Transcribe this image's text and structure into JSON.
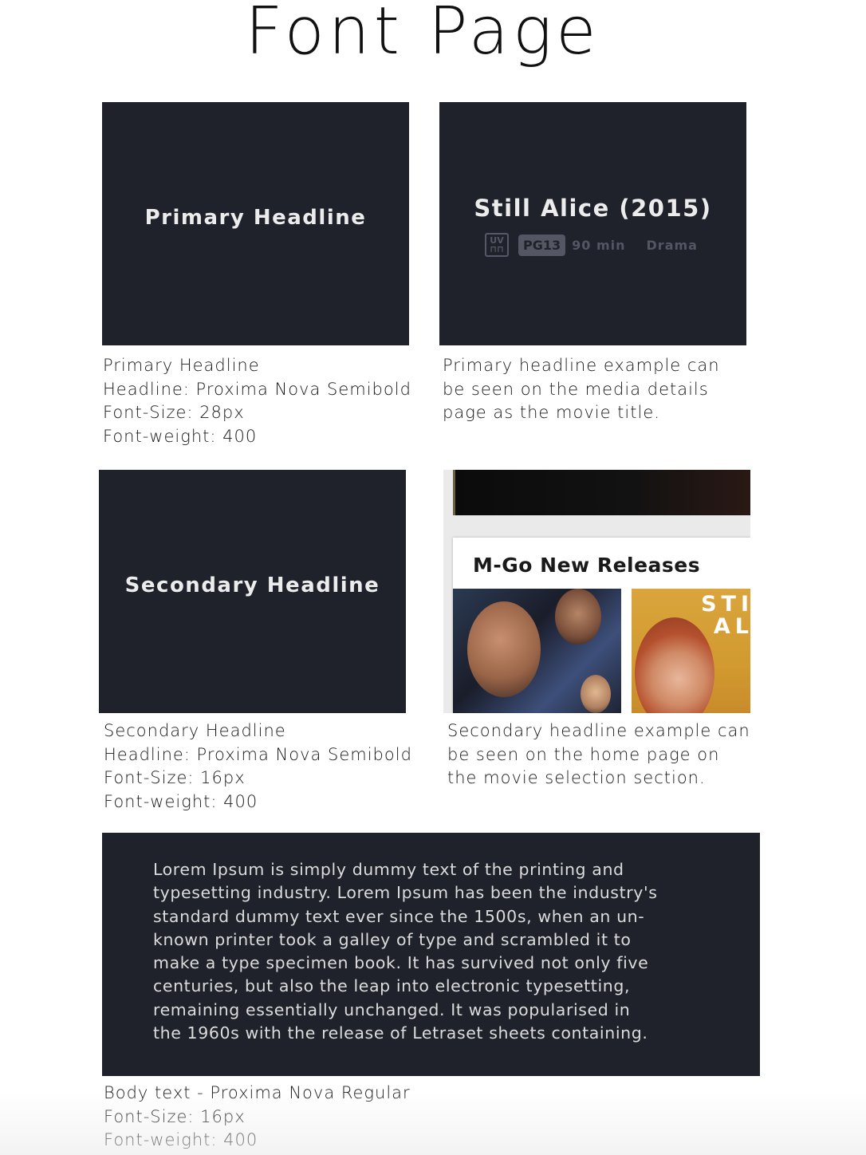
{
  "page": {
    "title": "Font Page"
  },
  "primary": {
    "sample": "Primary Headline",
    "caption": [
      "Primary Headline",
      "Headline: Proxima Nova Semibold",
      "Font-Size: 28px",
      "Font-weight: 400"
    ],
    "example": {
      "movie_title": "Still Alice (2015)",
      "uv_top": "UV",
      "uv_bottom": "⊓⊓",
      "rating": "PG13",
      "runtime": "90 min",
      "genre": "Drama"
    },
    "example_caption": [
      "Primary headline example can",
      "be seen on the media details",
      "page as the movie title."
    ]
  },
  "secondary": {
    "sample": "Secondary Headline",
    "caption": [
      "Secondary Headline",
      "Headline: Proxima Nova Semibold",
      "Font-Size: 16px",
      "Font-weight: 400"
    ],
    "example": {
      "section_title": "M-Go New Releases",
      "poster_2_title_line1": "STI",
      "poster_2_title_line2": "AL"
    },
    "example_caption": [
      "Secondary headline example can",
      "be seen on the home page on",
      "the movie selection section."
    ]
  },
  "body": {
    "sample_lines": [
      "Lorem Ipsum is simply dummy text of the printing and",
      "typesetting industry. Lorem Ipsum has been the industry's",
      "standard dummy text ever since the 1500s, when an un-",
      "known printer took a galley of type and scrambled it to",
      "make a type specimen book. It has survived not only five",
      "centuries, but also the leap into electronic typesetting,",
      "remaining essentially unchanged. It was popularised in",
      "the 1960s with the release of Letraset sheets containing."
    ],
    "caption": [
      "Body text - Proxima Nova Regular",
      "Font-Size: 16px",
      "Font-weight: 400"
    ]
  },
  "colors": {
    "panel_bg": "#1f212b",
    "panel_text": "#ececec",
    "muted": "#545763"
  }
}
